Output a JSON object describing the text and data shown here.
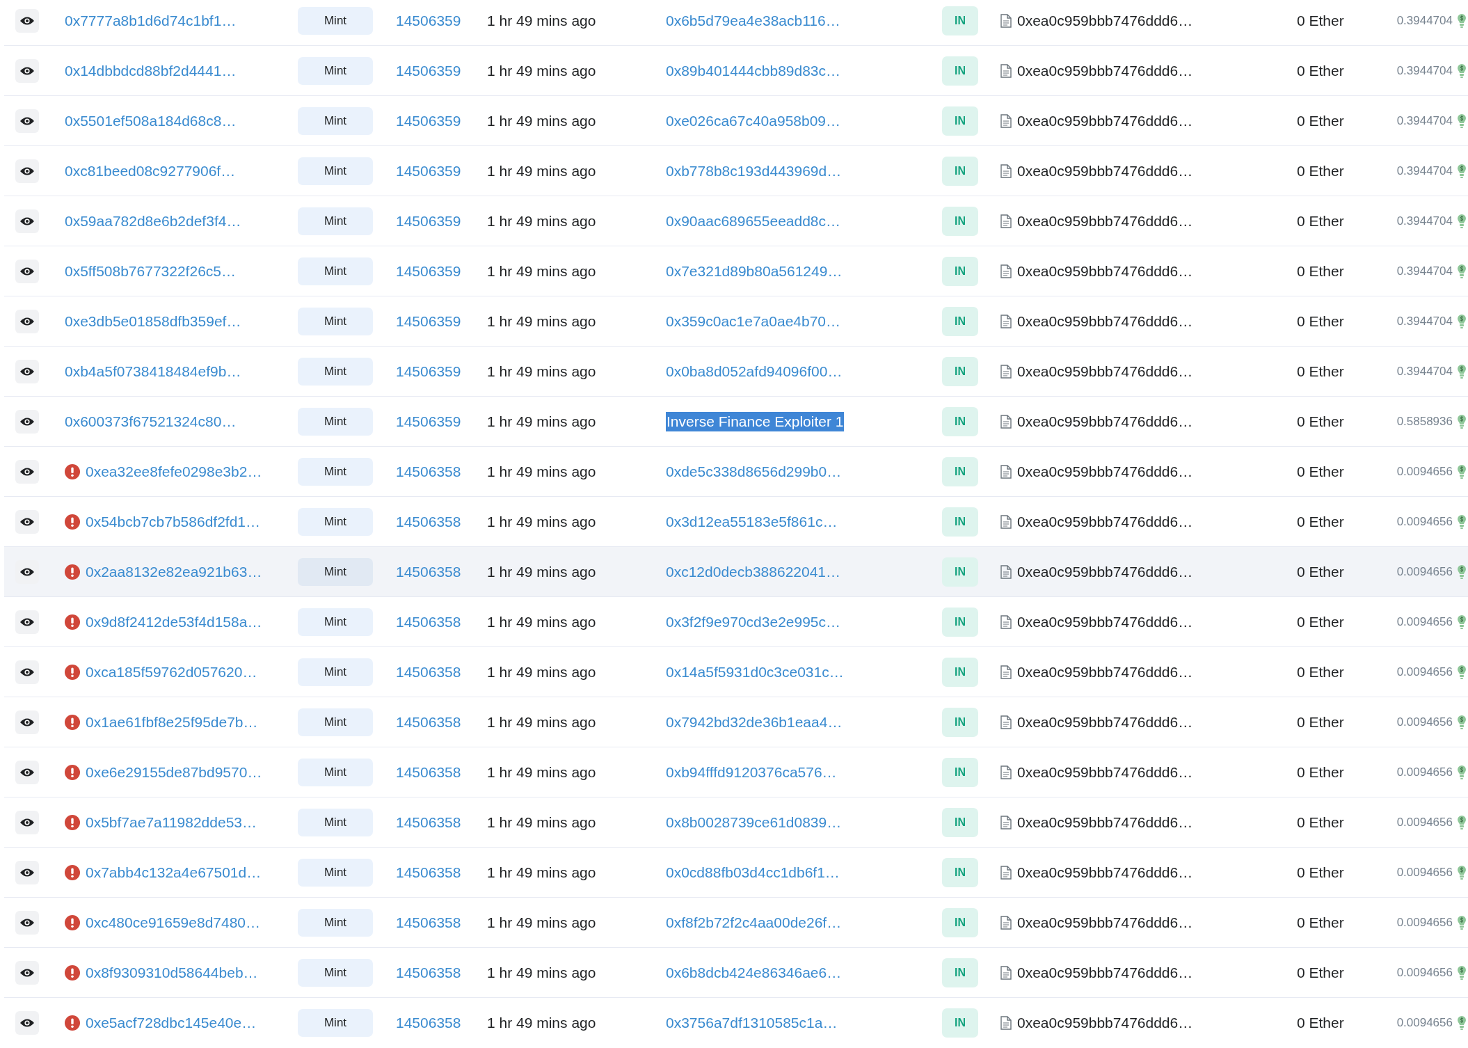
{
  "rows": [
    {
      "tx_hash": "0x7777a8b1d6d74c1bf1…",
      "error": false,
      "method": "Mint",
      "block": "14506359",
      "age": "1 hr 49 mins ago",
      "from": "0x6b5d79ea4e38acb116…",
      "from_selected": false,
      "direction": "IN",
      "to": "0xea0c959bbb7476ddd6…",
      "value": "0 Ether",
      "fee": "0.3944704",
      "highlighted": false
    },
    {
      "tx_hash": "0x14dbbdcd88bf2d4441…",
      "error": false,
      "method": "Mint",
      "block": "14506359",
      "age": "1 hr 49 mins ago",
      "from": "0x89b401444cbb89d83c…",
      "from_selected": false,
      "direction": "IN",
      "to": "0xea0c959bbb7476ddd6…",
      "value": "0 Ether",
      "fee": "0.3944704",
      "highlighted": false
    },
    {
      "tx_hash": "0x5501ef508a184d68c8…",
      "error": false,
      "method": "Mint",
      "block": "14506359",
      "age": "1 hr 49 mins ago",
      "from": "0xe026ca67c40a958b09…",
      "from_selected": false,
      "direction": "IN",
      "to": "0xea0c959bbb7476ddd6…",
      "value": "0 Ether",
      "fee": "0.3944704",
      "highlighted": false
    },
    {
      "tx_hash": "0xc81beed08c9277906f…",
      "error": false,
      "method": "Mint",
      "block": "14506359",
      "age": "1 hr 49 mins ago",
      "from": "0xb778b8c193d443969d…",
      "from_selected": false,
      "direction": "IN",
      "to": "0xea0c959bbb7476ddd6…",
      "value": "0 Ether",
      "fee": "0.3944704",
      "highlighted": false
    },
    {
      "tx_hash": "0x59aa782d8e6b2def3f4…",
      "error": false,
      "method": "Mint",
      "block": "14506359",
      "age": "1 hr 49 mins ago",
      "from": "0x90aac689655eeadd8c…",
      "from_selected": false,
      "direction": "IN",
      "to": "0xea0c959bbb7476ddd6…",
      "value": "0 Ether",
      "fee": "0.3944704",
      "highlighted": false
    },
    {
      "tx_hash": "0x5ff508b7677322f26c5…",
      "error": false,
      "method": "Mint",
      "block": "14506359",
      "age": "1 hr 49 mins ago",
      "from": "0x7e321d89b80a561249…",
      "from_selected": false,
      "direction": "IN",
      "to": "0xea0c959bbb7476ddd6…",
      "value": "0 Ether",
      "fee": "0.3944704",
      "highlighted": false
    },
    {
      "tx_hash": "0xe3db5e01858dfb359ef…",
      "error": false,
      "method": "Mint",
      "block": "14506359",
      "age": "1 hr 49 mins ago",
      "from": "0x359c0ac1e7a0ae4b70…",
      "from_selected": false,
      "direction": "IN",
      "to": "0xea0c959bbb7476ddd6…",
      "value": "0 Ether",
      "fee": "0.3944704",
      "highlighted": false
    },
    {
      "tx_hash": "0xb4a5f0738418484ef9b…",
      "error": false,
      "method": "Mint",
      "block": "14506359",
      "age": "1 hr 49 mins ago",
      "from": "0x0ba8d052afd94096f00…",
      "from_selected": false,
      "direction": "IN",
      "to": "0xea0c959bbb7476ddd6…",
      "value": "0 Ether",
      "fee": "0.3944704",
      "highlighted": false
    },
    {
      "tx_hash": "0x600373f67521324c80…",
      "error": false,
      "method": "Mint",
      "block": "14506359",
      "age": "1 hr 49 mins ago",
      "from": "Inverse Finance Exploiter 1",
      "from_selected": true,
      "direction": "IN",
      "to": "0xea0c959bbb7476ddd6…",
      "value": "0 Ether",
      "fee": "0.5858936",
      "highlighted": false
    },
    {
      "tx_hash": "0xea32ee8fefe0298e3b2…",
      "error": true,
      "method": "Mint",
      "block": "14506358",
      "age": "1 hr 49 mins ago",
      "from": "0xde5c338d8656d299b0…",
      "from_selected": false,
      "direction": "IN",
      "to": "0xea0c959bbb7476ddd6…",
      "value": "0 Ether",
      "fee": "0.0094656",
      "highlighted": false
    },
    {
      "tx_hash": "0x54bcb7cb7b586df2fd1…",
      "error": true,
      "method": "Mint",
      "block": "14506358",
      "age": "1 hr 49 mins ago",
      "from": "0x3d12ea55183e5f861c…",
      "from_selected": false,
      "direction": "IN",
      "to": "0xea0c959bbb7476ddd6…",
      "value": "0 Ether",
      "fee": "0.0094656",
      "highlighted": false
    },
    {
      "tx_hash": "0x2aa8132e82ea921b63…",
      "error": true,
      "method": "Mint",
      "block": "14506358",
      "age": "1 hr 49 mins ago",
      "from": "0xc12d0decb388622041…",
      "from_selected": false,
      "direction": "IN",
      "to": "0xea0c959bbb7476ddd6…",
      "value": "0 Ether",
      "fee": "0.0094656",
      "highlighted": true
    },
    {
      "tx_hash": "0x9d8f2412de53f4d158a…",
      "error": true,
      "method": "Mint",
      "block": "14506358",
      "age": "1 hr 49 mins ago",
      "from": "0x3f2f9e970cd3e2e995c…",
      "from_selected": false,
      "direction": "IN",
      "to": "0xea0c959bbb7476ddd6…",
      "value": "0 Ether",
      "fee": "0.0094656",
      "highlighted": false
    },
    {
      "tx_hash": "0xca185f59762d057620…",
      "error": true,
      "method": "Mint",
      "block": "14506358",
      "age": "1 hr 49 mins ago",
      "from": "0x14a5f5931d0c3ce031c…",
      "from_selected": false,
      "direction": "IN",
      "to": "0xea0c959bbb7476ddd6…",
      "value": "0 Ether",
      "fee": "0.0094656",
      "highlighted": false
    },
    {
      "tx_hash": "0x1ae61fbf8e25f95de7b…",
      "error": true,
      "method": "Mint",
      "block": "14506358",
      "age": "1 hr 49 mins ago",
      "from": "0x7942bd32de36b1eaa4…",
      "from_selected": false,
      "direction": "IN",
      "to": "0xea0c959bbb7476ddd6…",
      "value": "0 Ether",
      "fee": "0.0094656",
      "highlighted": false
    },
    {
      "tx_hash": "0xe6e29155de87bd9570…",
      "error": true,
      "method": "Mint",
      "block": "14506358",
      "age": "1 hr 49 mins ago",
      "from": "0xb94fffd9120376ca576…",
      "from_selected": false,
      "direction": "IN",
      "to": "0xea0c959bbb7476ddd6…",
      "value": "0 Ether",
      "fee": "0.0094656",
      "highlighted": false
    },
    {
      "tx_hash": "0x5bf7ae7a11982dde53…",
      "error": true,
      "method": "Mint",
      "block": "14506358",
      "age": "1 hr 49 mins ago",
      "from": "0x8b0028739ce61d0839…",
      "from_selected": false,
      "direction": "IN",
      "to": "0xea0c959bbb7476ddd6…",
      "value": "0 Ether",
      "fee": "0.0094656",
      "highlighted": false
    },
    {
      "tx_hash": "0x7abb4c132a4e67501d…",
      "error": true,
      "method": "Mint",
      "block": "14506358",
      "age": "1 hr 49 mins ago",
      "from": "0x0cd88fb03d4cc1db6f1…",
      "from_selected": false,
      "direction": "IN",
      "to": "0xea0c959bbb7476ddd6…",
      "value": "0 Ether",
      "fee": "0.0094656",
      "highlighted": false
    },
    {
      "tx_hash": "0xc480ce91659e8d7480…",
      "error": true,
      "method": "Mint",
      "block": "14506358",
      "age": "1 hr 49 mins ago",
      "from": "0xf8f2b72f2c4aa00de26f…",
      "from_selected": false,
      "direction": "IN",
      "to": "0xea0c959bbb7476ddd6…",
      "value": "0 Ether",
      "fee": "0.0094656",
      "highlighted": false
    },
    {
      "tx_hash": "0x8f9309310d58644beb…",
      "error": true,
      "method": "Mint",
      "block": "14506358",
      "age": "1 hr 49 mins ago",
      "from": "0x6b8dcb424e86346ae6…",
      "from_selected": false,
      "direction": "IN",
      "to": "0xea0c959bbb7476ddd6…",
      "value": "0 Ether",
      "fee": "0.0094656",
      "highlighted": false
    },
    {
      "tx_hash": "0xe5acf728dbc145e40e…",
      "error": true,
      "method": "Mint",
      "block": "14506358",
      "age": "1 hr 49 mins ago",
      "from": "0x3756a7df1310585c1a…",
      "from_selected": false,
      "direction": "IN",
      "to": "0xea0c959bbb7476ddd6…",
      "value": "0 Ether",
      "fee": "0.0094656",
      "highlighted": false
    }
  ]
}
